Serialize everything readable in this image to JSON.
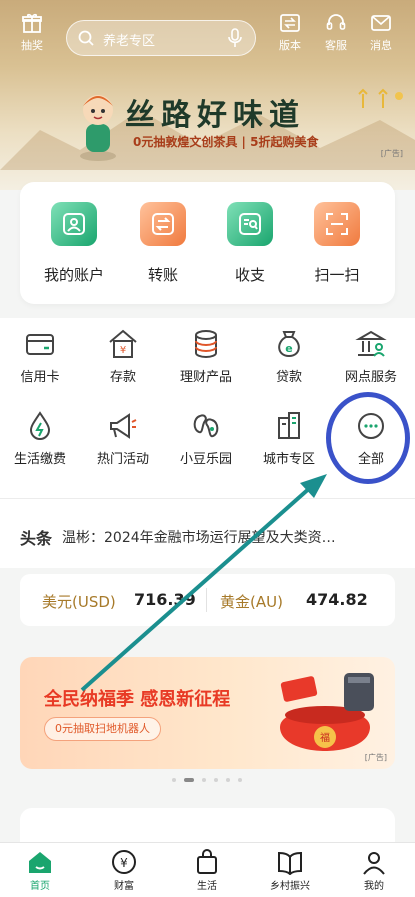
{
  "topbar": {
    "lottery_label": "抽奖",
    "search_placeholder": "养老专区",
    "version_label": "版本",
    "service_label": "客服",
    "message_label": "消息"
  },
  "banner": {
    "slogan": "丝路好味道",
    "subtitle": "0元抽敦煌文创茶具 | 5折起购美食",
    "ad_tag": "广告"
  },
  "quick_actions": [
    {
      "label": "我的账户",
      "icon": "account-icon"
    },
    {
      "label": "转账",
      "icon": "transfer-icon"
    },
    {
      "label": "收支",
      "icon": "income-expense-icon"
    },
    {
      "label": "扫一扫",
      "icon": "scan-icon"
    }
  ],
  "services": [
    {
      "label": "信用卡",
      "icon": "credit-card-icon"
    },
    {
      "label": "存款",
      "icon": "deposit-icon"
    },
    {
      "label": "理财产品",
      "icon": "wealth-product-icon"
    },
    {
      "label": "贷款",
      "icon": "loan-icon"
    },
    {
      "label": "网点服务",
      "icon": "branch-service-icon"
    },
    {
      "label": "生活缴费",
      "icon": "bill-payment-icon"
    },
    {
      "label": "热门活动",
      "icon": "megaphone-icon"
    },
    {
      "label": "小豆乐园",
      "icon": "bean-park-icon"
    },
    {
      "label": "城市专区",
      "icon": "city-icon"
    },
    {
      "label": "全部",
      "icon": "more-icon"
    }
  ],
  "headline": {
    "tag": "头条",
    "text": "温彬：2024年金融市场运行展望及大类资…"
  },
  "rates": {
    "usd_label": "美元(USD)",
    "usd_value": "716.39",
    "gold_label": "黄金(AU)",
    "gold_value": "474.82"
  },
  "promo": {
    "title": "全民纳福季 感恩新征程",
    "button": "0元抽取扫地机器人",
    "ad_tag": "广告",
    "carousel_index": 2,
    "carousel_count": 6
  },
  "bottom_nav": [
    {
      "label": "首页",
      "icon": "home-icon",
      "active": true
    },
    {
      "label": "财富",
      "icon": "wealth-icon",
      "active": false
    },
    {
      "label": "生活",
      "icon": "shopping-bag-icon",
      "active": false
    },
    {
      "label": "乡村振兴",
      "icon": "book-icon",
      "active": false
    },
    {
      "label": "我的",
      "icon": "profile-icon",
      "active": false
    }
  ],
  "colors": {
    "brand_green": "#1aa56e",
    "accent_orange": "#f07a3e",
    "annotation_blue": "#3a52c9",
    "annotation_arrow": "#1b8f8f"
  }
}
